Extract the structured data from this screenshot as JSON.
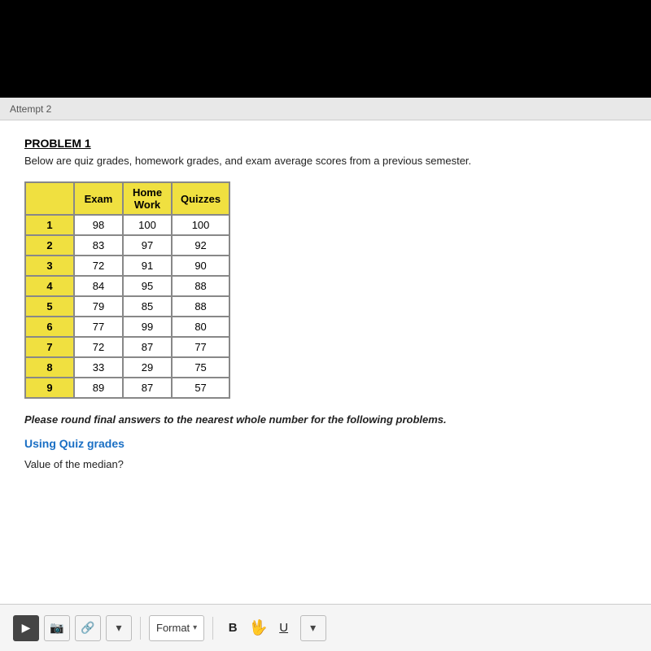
{
  "topBar": {
    "text": "Attempt 2"
  },
  "problem": {
    "title": "PROBLEM 1",
    "description": "Below are quiz grades, homework grades, and exam average scores from a previous semester."
  },
  "table": {
    "headers": [
      "",
      "Exam",
      "Home Work",
      "Quizzes"
    ],
    "rows": [
      {
        "num": "1",
        "exam": "98",
        "homework": "100",
        "quizzes": "100"
      },
      {
        "num": "2",
        "exam": "83",
        "homework": "97",
        "quizzes": "92"
      },
      {
        "num": "3",
        "exam": "72",
        "homework": "91",
        "quizzes": "90"
      },
      {
        "num": "4",
        "exam": "84",
        "homework": "95",
        "quizzes": "88"
      },
      {
        "num": "5",
        "exam": "79",
        "homework": "85",
        "quizzes": "88"
      },
      {
        "num": "6",
        "exam": "77",
        "homework": "99",
        "quizzes": "80"
      },
      {
        "num": "7",
        "exam": "72",
        "homework": "87",
        "quizzes": "77"
      },
      {
        "num": "8",
        "exam": "33",
        "homework": "29",
        "quizzes": "75"
      },
      {
        "num": "9",
        "exam": "89",
        "homework": "87",
        "quizzes": "57"
      }
    ]
  },
  "note": "Please round final answers to the nearest whole number for the following problems.",
  "sectionLabel": "Using Quiz grades",
  "question": "Value of the median?",
  "toolbar": {
    "format_label": "Format",
    "bold_label": "B",
    "underline_label": "U"
  }
}
